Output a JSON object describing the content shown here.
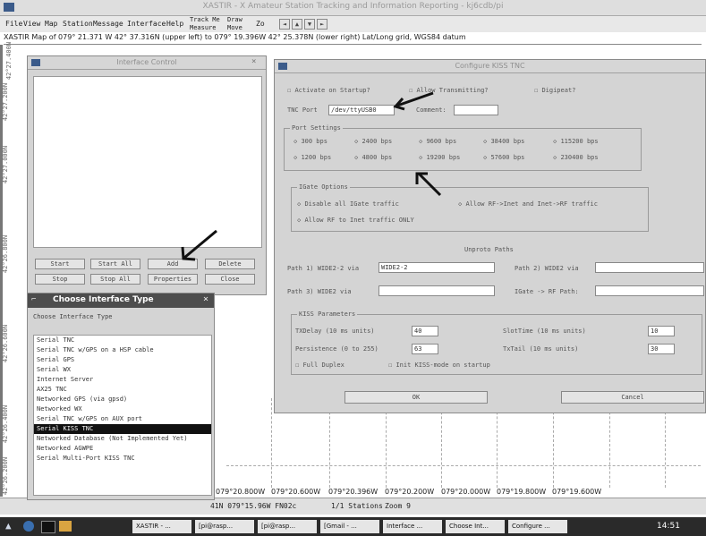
{
  "app": {
    "title": "XASTIR - X Amateur Station Tracking and Information Reporting - kj6cdb/pi",
    "status_line": "XASTIR Map of 079° 21.371 W 42° 37.316N (upper left) to 079° 19.396W 42° 25.378N (lower right)   Lat/Long grid, WGS84 datum"
  },
  "menu": {
    "items": [
      "File",
      "View",
      "Map",
      "Station",
      "Message",
      "Interface",
      "Help"
    ],
    "toolbar": {
      "track_me": "Track Me",
      "measure": "Measure",
      "draw": "Draw",
      "move": "Move",
      "zoom": "Zo",
      "nav": [
        "◄",
        "▲",
        "▼",
        "►"
      ]
    }
  },
  "map": {
    "left_labels": [
      "42°27.400N",
      "42°27.200N",
      "42°27.000N",
      "42°26.800N",
      "42°26.600N",
      "42°26.400N",
      "42°26.200N"
    ],
    "bottom_labels": [
      "079°20.800W",
      "079°20.600W",
      "079°20.396W",
      "079°20.200W",
      "079°20.000W",
      "079°19.800W",
      "079°19.600W"
    ]
  },
  "status_bar": {
    "coords": "41N  079°15.96W  FN02c",
    "stations": "1/1 Stations",
    "zoom": "Zoom 9"
  },
  "interface_control": {
    "title": "Interface Control",
    "buttons": [
      "Start",
      "Start All",
      "Add",
      "Delete",
      "Stop",
      "Stop All",
      "Properties",
      "Close"
    ]
  },
  "choose_interface": {
    "title": "Choose Interface Type",
    "label": "Choose Interface Type",
    "items": [
      "Serial TNC",
      "Serial TNC w/GPS on a HSP cable",
      "Serial GPS",
      "Serial WX",
      "Internet Server",
      "AX25 TNC",
      "Networked GPS (via gpsd)",
      "Networked WX",
      "Serial TNC w/GPS on AUX port",
      "Serial KISS TNC",
      "Networked Database (Not Implemented Yet)",
      "Networked AGWPE",
      "Serial Multi-Port KISS TNC"
    ],
    "selected_index": 9
  },
  "configure_kiss": {
    "title": "Configure KISS TNC",
    "checks": {
      "activate": "Activate on Startup?",
      "transmit": "Allow Transmitting?",
      "digipeat": "Digipeat?"
    },
    "tnc_port_label": "TNC Port",
    "tnc_port_value": "/dev/ttyUSB0",
    "comment_label": "Comment:",
    "comment_value": "",
    "port_settings_title": "Port Settings",
    "bauds_row1": [
      "300 bps",
      "2400 bps",
      "9600 bps",
      "38400 bps",
      "115200 bps"
    ],
    "bauds_row2": [
      "1200 bps",
      "4800 bps",
      "19200 bps",
      "57600 bps",
      "230400 bps"
    ],
    "igate_title": "IGate Options",
    "igate_opts": [
      "Disable all IGate traffic",
      "Allow RF->Inet and Inet->RF traffic",
      "Allow RF to Inet traffic ONLY"
    ],
    "unproto_title": "Unproto Paths",
    "path1_label": "Path 1) WIDE2-2 via",
    "path1_value": "WIDE2-2",
    "path2_label": "Path 2) WIDE2 via",
    "path2_value": "",
    "path3_label": "Path 3) WIDE2 via",
    "path3_value": "",
    "igate_rf_label": "IGate -> RF Path:",
    "igate_rf_value": "",
    "kiss_title": "KISS Parameters",
    "txdelay_label": "TXDelay (10 ms units)",
    "txdelay_value": "40",
    "slottime_label": "SlotTime (10 ms units)",
    "slottime_value": "10",
    "persistence_label": "Persistence (0 to 255)",
    "persistence_value": "63",
    "txtail_label": "TxTail (10 ms units)",
    "txtail_value": "30",
    "full_duplex": "Full Duplex",
    "init_kiss": "Init KISS-mode on startup",
    "ok": "OK",
    "cancel": "Cancel"
  },
  "taskbar": {
    "items": [
      "XASTIR - ...",
      "[pi@rasp...",
      "[pi@rasp...",
      "[Gmail - ...",
      "Interface ...",
      "Choose Int...",
      "Configure ..."
    ],
    "clock": "14:51"
  }
}
